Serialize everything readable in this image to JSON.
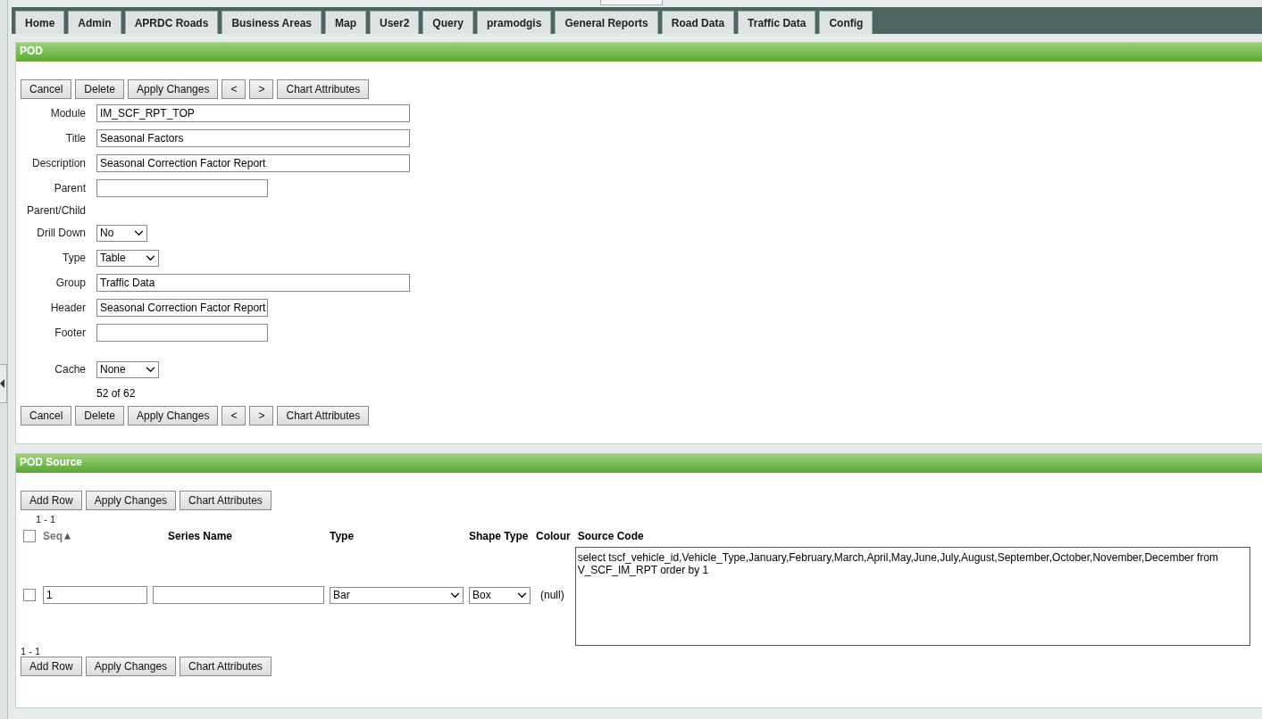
{
  "tabs": [
    {
      "label": "Home",
      "selected": false
    },
    {
      "label": "Admin",
      "selected": false
    },
    {
      "label": "APRDC Roads",
      "selected": false
    },
    {
      "label": "Business Areas",
      "selected": false
    },
    {
      "label": "Map",
      "selected": false
    },
    {
      "label": "User2",
      "selected": false
    },
    {
      "label": "Query",
      "selected": false
    },
    {
      "label": "pramodgis",
      "selected": false
    },
    {
      "label": "General Reports",
      "selected": false
    },
    {
      "label": "Road Data",
      "selected": false
    },
    {
      "label": "Traffic Data",
      "selected": false
    },
    {
      "label": "Config",
      "selected": false
    }
  ],
  "pod": {
    "title": "POD",
    "buttons": [
      "Cancel",
      "Delete",
      "Apply Changes",
      "<",
      ">",
      "Chart Attributes"
    ],
    "fields": [
      {
        "label": "Module",
        "kind": "wide_text",
        "value": "IM_SCF_RPT_TOP"
      },
      {
        "label": "Title",
        "kind": "wide_text",
        "value": "Seasonal Factors"
      },
      {
        "label": "Description",
        "kind": "wide_text",
        "value": "Seasonal Correction Factor Report"
      },
      {
        "label": "Parent",
        "kind": "text"
      },
      {
        "label": "Parent/Child",
        "kind": "static"
      },
      {
        "label": "Drill Down",
        "kind": "select",
        "value": "No"
      },
      {
        "label": "Type",
        "kind": "select",
        "value": "Table"
      },
      {
        "label": "Group",
        "kind": "wide_text",
        "value": "Traffic Data"
      },
      {
        "label": "Header",
        "kind": "text",
        "value": "Seasonal Correction Factor Report"
      },
      {
        "label": "Footer",
        "kind": "text"
      },
      {
        "label": "Cache",
        "kind": "select",
        "value": "None"
      }
    ],
    "record_count": "52 of 62",
    "bottom_buttons": [
      "Cancel",
      "Delete",
      "Apply Changes",
      "<",
      ">",
      "Chart Attributes"
    ]
  },
  "pod_source": {
    "title": "POD Source",
    "buttons": [
      "Add Row",
      "Apply Changes",
      "Chart Attributes"
    ],
    "range_top": "1 - 1",
    "select_all_checked": false,
    "columns": [
      "Seq",
      "Series Name",
      "Type",
      "Shape Type",
      "Colour",
      "Source Code"
    ],
    "rows": [
      {
        "checked": false,
        "seq": "1",
        "type": "Bar",
        "shape_type": "Box",
        "colour": "(null)",
        "source_code": "select tscf_vehicle_id,Vehicle_Type,January,February,March,April,May,June,July,August,September,October,November,December from V_SCF_IM_RPT order by 1"
      }
    ],
    "range_bottom": "1 - 1",
    "bottom_buttons": [
      "Add Row",
      "Apply Changes",
      "Chart Attributes"
    ]
  }
}
